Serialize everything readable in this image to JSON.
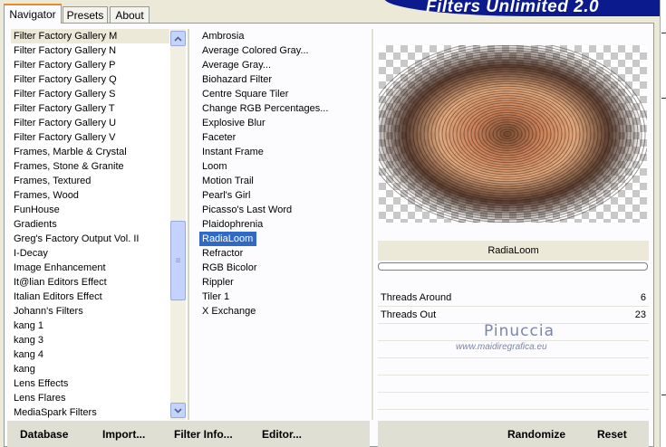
{
  "tabs": [
    "Navigator",
    "Presets",
    "About"
  ],
  "app_title": "Filters Unlimited 2.0",
  "categories": [
    "Filter Factory Gallery M",
    "Filter Factory Gallery N",
    "Filter Factory Gallery P",
    "Filter Factory Gallery Q",
    "Filter Factory Gallery S",
    "Filter Factory Gallery T",
    "Filter Factory Gallery U",
    "Filter Factory Gallery V",
    "Frames, Marble & Crystal",
    "Frames, Stone & Granite",
    "Frames, Textured",
    "Frames, Wood",
    "FunHouse",
    "Gradients",
    "Greg's Factory Output Vol. II",
    "I-Decay",
    "Image Enhancement",
    "It@lian Editors Effect",
    "Italian Editors Effect",
    "Johann's Filters",
    "kang 1",
    "kang 3",
    "kang 4",
    "kang",
    "Lens Effects",
    "Lens Flares",
    "MediaSpark Filters"
  ],
  "filters": [
    "Ambrosia",
    "Average Colored Gray...",
    "Average Gray...",
    "Biohazard Filter",
    "Centre Square Tiler",
    "Change RGB Percentages...",
    "Explosive Blur",
    "Faceter",
    "Instant Frame",
    "Loom",
    "Motion Trail",
    "Pearl's Girl",
    "Picasso's Last Word",
    "Plaidophrenia",
    "RadiaLoom",
    "Refractor",
    "RGB Bicolor",
    "Rippler",
    "Tiler 1",
    "X Exchange"
  ],
  "selected_category": "Filter Factory Gallery M",
  "selected_filter": "RadiaLoom",
  "preview": {
    "filter_name": "RadiaLoom"
  },
  "params": [
    {
      "name": "Threads Around",
      "value": "6"
    },
    {
      "name": "Threads Out",
      "value": "23"
    }
  ],
  "watermark": {
    "name": "Pinuccia",
    "url": "www.maidiregrafica.eu"
  },
  "buttons": {
    "database": "Database",
    "import": "Import...",
    "filter_info": "Filter Info...",
    "editor": "Editor...",
    "randomize": "Randomize",
    "reset": "Reset"
  }
}
